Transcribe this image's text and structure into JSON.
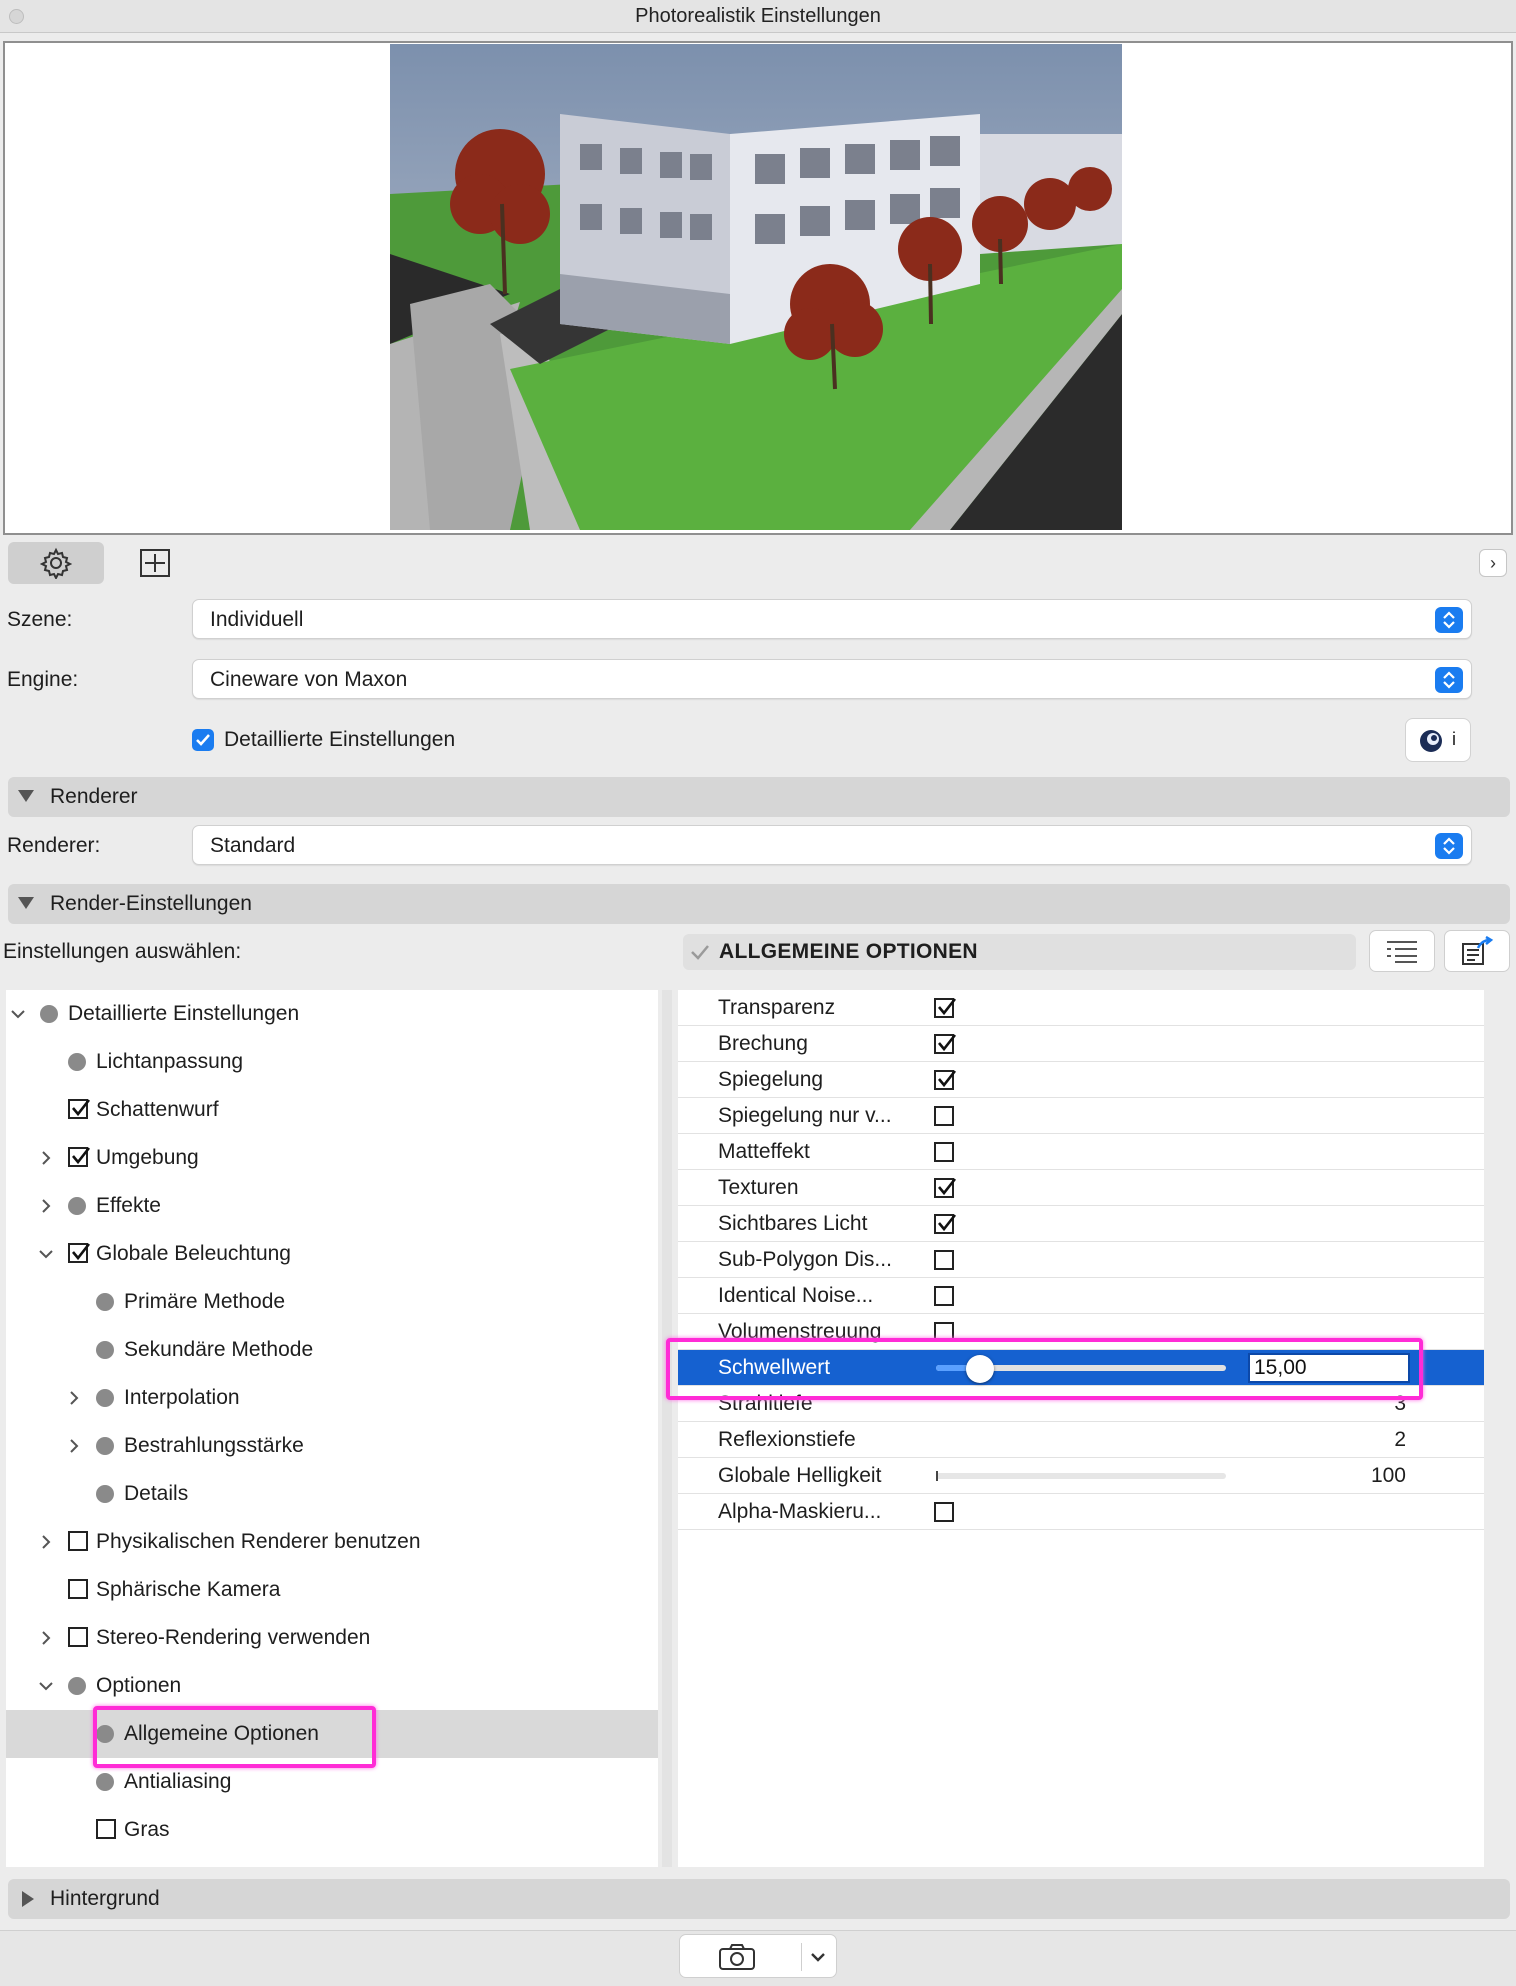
{
  "window": {
    "title": "Photorealistik Einstellungen"
  },
  "toolbar": {
    "settings_icon": "gear-icon",
    "size_icon": "frame-size-icon",
    "expand_icon": "chevron-right-icon"
  },
  "form": {
    "scene_label": "Szene:",
    "scene_value": "Individuell",
    "engine_label": "Engine:",
    "engine_value": "Cineware von Maxon",
    "detailed_label": "Detaillierte Einstellungen",
    "info_label": "i"
  },
  "renderer_section": {
    "title": "Renderer",
    "label": "Renderer:",
    "value": "Standard"
  },
  "render_settings_section": {
    "title": "Render-Einstellungen",
    "select_label": "Einstellungen auswählen:",
    "group_title": "ALLGEMEINE OPTIONEN"
  },
  "tree": [
    {
      "label": "Detaillierte Einstellungen",
      "level": 0,
      "marker": "bullet",
      "expander": "down"
    },
    {
      "label": "Lichtanpassung",
      "level": 1,
      "marker": "bullet",
      "expander": "none"
    },
    {
      "label": "Schattenwurf",
      "level": 1,
      "marker": "checked",
      "expander": "none"
    },
    {
      "label": "Umgebung",
      "level": 1,
      "marker": "checked",
      "expander": "right"
    },
    {
      "label": "Effekte",
      "level": 1,
      "marker": "bullet",
      "expander": "right"
    },
    {
      "label": "Globale Beleuchtung",
      "level": 1,
      "marker": "checked",
      "expander": "down"
    },
    {
      "label": "Primäre Methode",
      "level": 2,
      "marker": "bullet",
      "expander": "none"
    },
    {
      "label": "Sekundäre Methode",
      "level": 2,
      "marker": "bullet",
      "expander": "none"
    },
    {
      "label": "Interpolation",
      "level": 2,
      "marker": "bullet",
      "expander": "right"
    },
    {
      "label": "Bestrahlungsstärke",
      "level": 2,
      "marker": "bullet",
      "expander": "right"
    },
    {
      "label": "Details",
      "level": 2,
      "marker": "bullet",
      "expander": "none"
    },
    {
      "label": "Physikalischen Renderer benutzen",
      "level": 1,
      "marker": "unchecked",
      "expander": "right"
    },
    {
      "label": "Sphärische Kamera",
      "level": 1,
      "marker": "unchecked",
      "expander": "none"
    },
    {
      "label": "Stereo-Rendering verwenden",
      "level": 1,
      "marker": "unchecked",
      "expander": "right"
    },
    {
      "label": "Optionen",
      "level": 1,
      "marker": "bullet",
      "expander": "down"
    },
    {
      "label": "Allgemeine Optionen",
      "level": 2,
      "marker": "bullet",
      "expander": "none",
      "selected": true
    },
    {
      "label": "Antialiasing",
      "level": 2,
      "marker": "bullet",
      "expander": "none"
    },
    {
      "label": "Gras",
      "level": 2,
      "marker": "unchecked",
      "expander": "none"
    }
  ],
  "properties": [
    {
      "name": "Transparenz",
      "type": "checkbox",
      "checked": true
    },
    {
      "name": "Brechung",
      "type": "checkbox",
      "checked": true
    },
    {
      "name": "Spiegelung",
      "type": "checkbox",
      "checked": true
    },
    {
      "name": "Spiegelung nur v...",
      "type": "checkbox",
      "checked": false
    },
    {
      "name": "Matteffekt",
      "type": "checkbox",
      "checked": false
    },
    {
      "name": "Texturen",
      "type": "checkbox",
      "checked": true
    },
    {
      "name": "Sichtbares Licht",
      "type": "checkbox",
      "checked": true
    },
    {
      "name": "Sub-Polygon Dis...",
      "type": "checkbox",
      "checked": false
    },
    {
      "name": "Identical Noise...",
      "type": "checkbox",
      "checked": false
    },
    {
      "name": "Volumenstreuung",
      "type": "checkbox",
      "checked": false
    },
    {
      "name": "Schwellwert",
      "type": "slider-active",
      "value": "15,00",
      "level": 0.15
    },
    {
      "name": "Strahltiefe",
      "type": "value",
      "value": "3"
    },
    {
      "name": "Reflexionstiefe",
      "type": "value",
      "value": "2"
    },
    {
      "name": "Globale Helligkeit",
      "type": "slider",
      "value": "100",
      "level": 0
    },
    {
      "name": "Alpha-Maskieru...",
      "type": "checkbox",
      "checked": false
    }
  ],
  "background_section": {
    "title": "Hintergrund"
  },
  "bottom": {
    "camera_icon": "camera-icon",
    "dropdown_icon": "chevron-down-icon"
  },
  "colors": {
    "accent": "#1a7cf0",
    "selection": "#1561d0",
    "highlight": "#ff2bd6"
  }
}
